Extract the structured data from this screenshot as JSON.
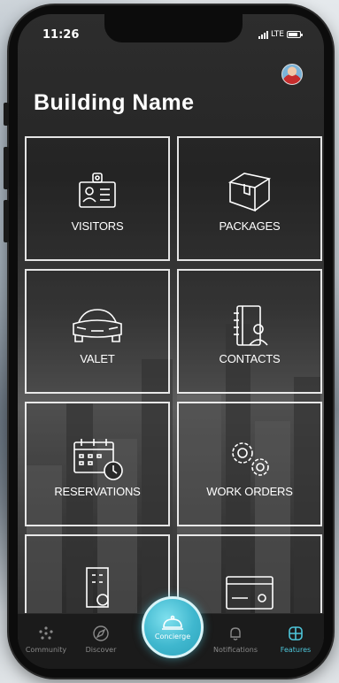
{
  "status": {
    "time": "11:26",
    "carrier": "LTE"
  },
  "title": "Building Name",
  "tiles": [
    {
      "label": "VISITORS",
      "icon": "id-badge-icon"
    },
    {
      "label": "PACKAGES",
      "icon": "package-box-icon"
    },
    {
      "label": "VALET",
      "icon": "car-icon"
    },
    {
      "label": "CONTACTS",
      "icon": "contacts-book-icon"
    },
    {
      "label": "RESERVATIONS",
      "icon": "calendar-clock-icon"
    },
    {
      "label": "WORK ORDERS",
      "icon": "gears-icon"
    },
    {
      "label": "",
      "icon": "building-icon"
    },
    {
      "label": "",
      "icon": "card-icon"
    }
  ],
  "tabs": {
    "community": "Community",
    "discover": "Discover",
    "concierge": "Concierge",
    "notifications": "Notifications",
    "features": "Features"
  },
  "colors": {
    "accent": "#4ec6da",
    "background": "#2d2d2d"
  }
}
